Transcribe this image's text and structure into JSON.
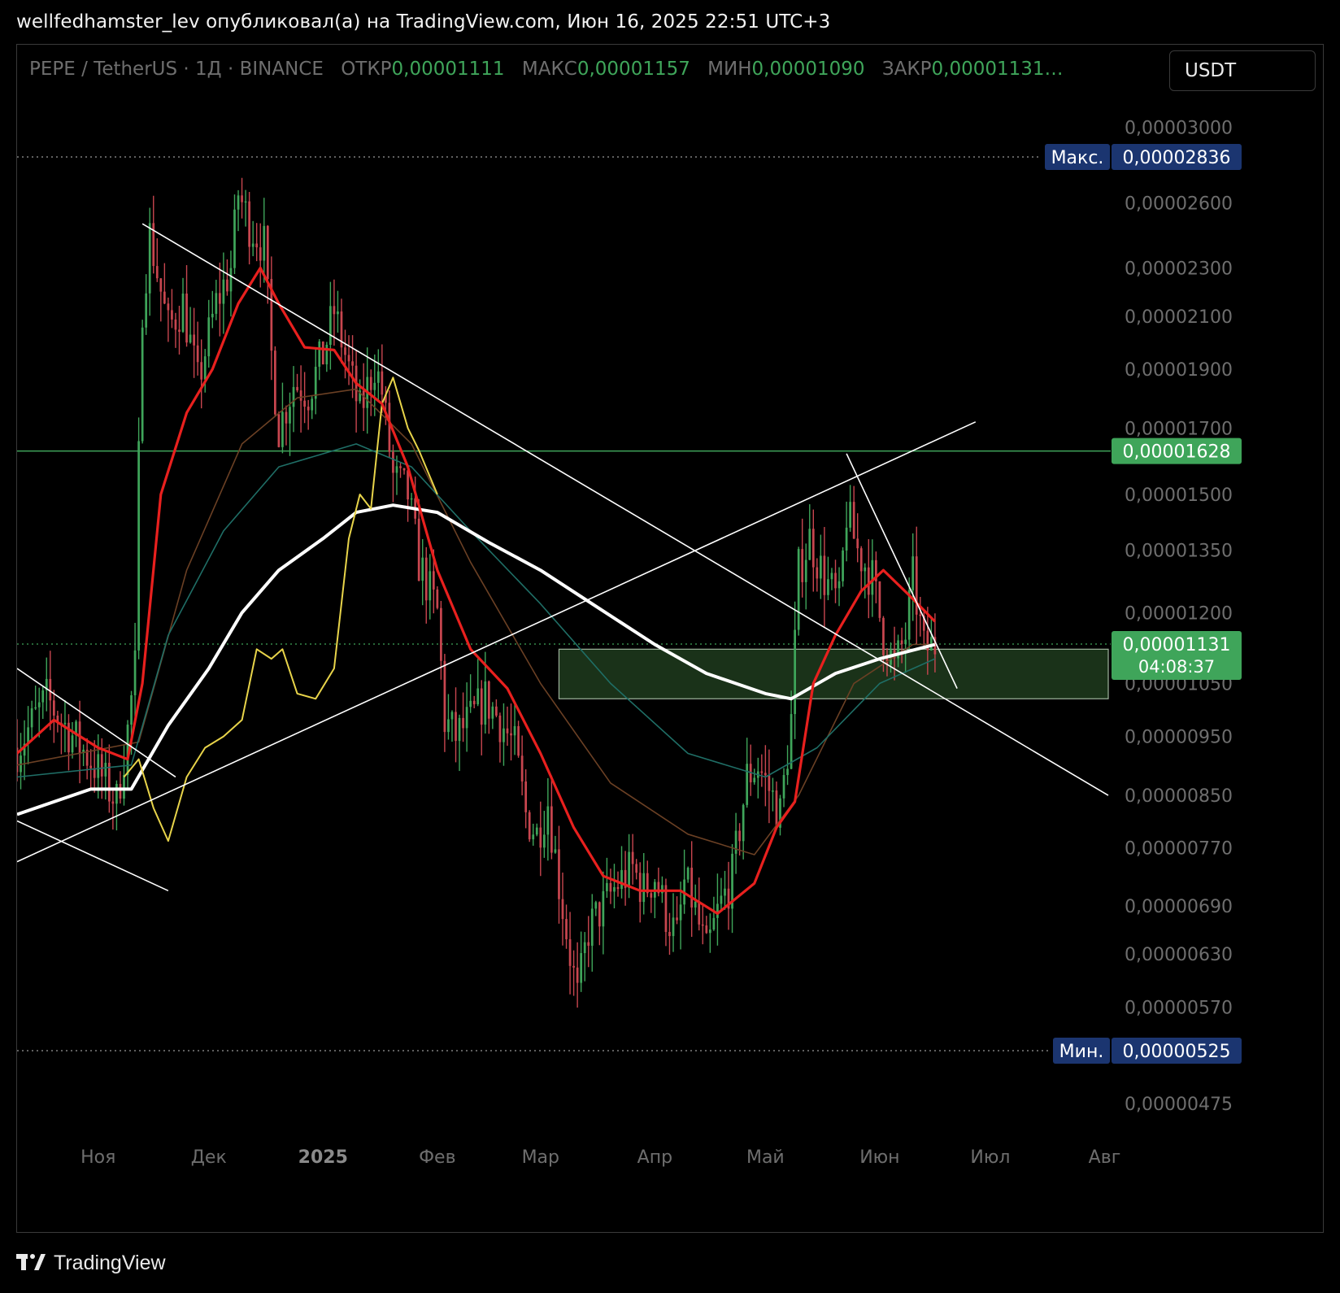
{
  "header": {
    "published_line": "wellfedhamster_lev опубликовал(а) на TradingView.com, Июн 16, 2025 22:51 UTC+3"
  },
  "legend": {
    "symbol": "PEPE / TetherUS · 1Д · BINANCE",
    "open_label": "ОТКР",
    "open_value": "0,00001111",
    "high_label": "МАКС",
    "high_value": "0,00001157",
    "low_label": "МИН",
    "low_value": "0,00001090",
    "close_label": "ЗАКР",
    "close_value": "0,00001131…"
  },
  "currency_selector": "USDT",
  "footer": {
    "brand": "TradingView"
  },
  "colors": {
    "up": "#3fa55a",
    "down": "#c8464f",
    "ma_red": "#e8201e",
    "ma_white": "#ffffff",
    "ma_teal": "#1f6e66",
    "ma_brown": "#6b4024",
    "oscillator": "#e8d44a",
    "zone_fill": "#1e3b1d",
    "price_tag_green": "#3fa55a",
    "extreme_tag": "#1b3570"
  },
  "chart_data": {
    "type": "candlestick",
    "pair": "PEPE / TetherUS",
    "interval": "1Д",
    "exchange": "BINANCE",
    "y_scale": "log",
    "ylim": [
      4.4e-06,
      3.2e-06
    ],
    "y_ticks": [
      "0,00003000",
      "0,00002600",
      "0,00002300",
      "0,00002100",
      "0,00001900",
      "0,00001700",
      "0,00001500",
      "0,00001350",
      "0,00001200",
      "0,00001050",
      "0,00000950",
      "0,00000850",
      "0,00000770",
      "0,00000690",
      "0,00000630",
      "0,00000570",
      "0,00000475"
    ],
    "y_tick_values": [
      3e-05,
      2.6e-05,
      2.3e-05,
      2.1e-05,
      1.9e-05,
      1.7e-05,
      1.5e-05,
      1.35e-05,
      1.2e-05,
      1.05e-05,
      9.5e-06,
      8.5e-06,
      7.7e-06,
      6.9e-06,
      6.3e-06,
      5.7e-06,
      4.75e-06
    ],
    "x_ticks": [
      "Ноя",
      "Дек",
      "2025",
      "Фев",
      "Мар",
      "Апр",
      "Май",
      "Июн",
      "Июл",
      "Авг"
    ],
    "x_tick_dates": [
      "2024-11-01",
      "2024-12-01",
      "2025-01-01",
      "2025-02-01",
      "2025-03-01",
      "2025-04-01",
      "2025-05-01",
      "2025-06-01",
      "2025-07-01",
      "2025-08-01"
    ],
    "x_range": [
      "2024-10-10",
      "2025-08-02"
    ],
    "max": {
      "label": "Макс.",
      "value": "0,00002836",
      "y": 2.836e-05,
      "date": "2024-12-09"
    },
    "min": {
      "label": "Мин.",
      "value": "0,00000525",
      "y": 5.25e-06,
      "date": "2025-03-11"
    },
    "current_price": {
      "value": "0,00001131",
      "countdown": "04:08:37",
      "y": 1.131e-05
    },
    "resistance_level": {
      "value": "0,00001628",
      "y": 1.628e-05
    },
    "support_zone": {
      "from": "2025-03-06",
      "to": "2025-08-02",
      "low": 1.02e-05,
      "high": 1.12e-05
    },
    "grid": false,
    "series_points": {
      "close": [
        [
          "2024-10-10",
          9.3e-06
        ],
        [
          "2024-10-18",
          1.02e-05
        ],
        [
          "2024-10-24",
          9.6e-06
        ],
        [
          "2024-10-31",
          9e-06
        ],
        [
          "2024-11-06",
          8.4e-06
        ],
        [
          "2024-11-09",
          9.6e-06
        ],
        [
          "2024-11-11",
          1.08e-05
        ],
        [
          "2024-11-12",
          1.6e-05
        ],
        [
          "2024-11-13",
          2.15e-05
        ],
        [
          "2024-11-15",
          2.45e-05
        ],
        [
          "2024-11-20",
          2.05e-05
        ],
        [
          "2024-11-24",
          2.15e-05
        ],
        [
          "2024-11-28",
          1.85e-05
        ],
        [
          "2024-12-03",
          2.15e-05
        ],
        [
          "2024-12-07",
          2.3e-05
        ],
        [
          "2024-12-09",
          2.65e-05
        ],
        [
          "2024-12-12",
          2.5e-05
        ],
        [
          "2024-12-16",
          2.4e-05
        ],
        [
          "2024-12-18",
          1.95e-05
        ],
        [
          "2024-12-20",
          1.7e-05
        ],
        [
          "2024-12-24",
          1.85e-05
        ],
        [
          "2024-12-28",
          1.82e-05
        ],
        [
          "2025-01-01",
          1.95e-05
        ],
        [
          "2025-01-04",
          2.12e-05
        ],
        [
          "2025-01-08",
          1.9e-05
        ],
        [
          "2025-01-11",
          1.75e-05
        ],
        [
          "2025-01-15",
          1.92e-05
        ],
        [
          "2025-01-17",
          1.82e-05
        ],
        [
          "2025-01-20",
          1.55e-05
        ],
        [
          "2025-01-24",
          1.5e-05
        ],
        [
          "2025-01-27",
          1.32e-05
        ],
        [
          "2025-02-01",
          1.2e-05
        ],
        [
          "2025-02-03",
          9.8e-06
        ],
        [
          "2025-02-06",
          9.5e-06
        ],
        [
          "2025-02-10",
          9.8e-06
        ],
        [
          "2025-02-14",
          1.02e-05
        ],
        [
          "2025-02-18",
          9.8e-06
        ],
        [
          "2025-02-22",
          9.3e-06
        ],
        [
          "2025-02-25",
          8.2e-06
        ],
        [
          "2025-02-28",
          7.9e-06
        ],
        [
          "2025-03-03",
          8.4e-06
        ],
        [
          "2025-03-06",
          7.2e-06
        ],
        [
          "2025-03-09",
          6.3e-06
        ],
        [
          "2025-03-11",
          5.8e-06
        ],
        [
          "2025-03-14",
          6.6e-06
        ],
        [
          "2025-03-18",
          6.9e-06
        ],
        [
          "2025-03-22",
          7.2e-06
        ],
        [
          "2025-03-26",
          7.4e-06
        ],
        [
          "2025-03-29",
          7.1e-06
        ],
        [
          "2025-04-01",
          7.3e-06
        ],
        [
          "2025-04-04",
          6.8e-06
        ],
        [
          "2025-04-07",
          6.5e-06
        ],
        [
          "2025-04-09",
          7.2e-06
        ],
        [
          "2025-04-11",
          7e-06
        ],
        [
          "2025-04-15",
          6.3e-06
        ],
        [
          "2025-04-18",
          6.8e-06
        ],
        [
          "2025-04-22",
          7.3e-06
        ],
        [
          "2025-04-26",
          8.8e-06
        ],
        [
          "2025-04-29",
          9e-06
        ],
        [
          "2025-05-02",
          8.6e-06
        ],
        [
          "2025-05-05",
          8.2e-06
        ],
        [
          "2025-05-08",
          9.8e-06
        ],
        [
          "2025-05-10",
          1.3e-05
        ],
        [
          "2025-05-13",
          1.38e-05
        ],
        [
          "2025-05-17",
          1.28e-05
        ],
        [
          "2025-05-21",
          1.22e-05
        ],
        [
          "2025-05-23",
          1.45e-05
        ],
        [
          "2025-05-26",
          1.35e-05
        ],
        [
          "2025-05-30",
          1.28e-05
        ],
        [
          "2025-06-02",
          1.15e-05
        ],
        [
          "2025-06-05",
          1.08e-05
        ],
        [
          "2025-06-08",
          1.15e-05
        ],
        [
          "2025-06-10",
          1.28e-05
        ],
        [
          "2025-06-13",
          1.12e-05
        ],
        [
          "2025-06-16",
          1.13e-05
        ]
      ],
      "ma_red": [
        [
          "2024-10-10",
          9.2e-06
        ],
        [
          "2024-10-20",
          9.8e-06
        ],
        [
          "2024-11-01",
          9.3e-06
        ],
        [
          "2024-11-09",
          9.1e-06
        ],
        [
          "2024-11-13",
          1.05e-05
        ],
        [
          "2024-11-18",
          1.5e-05
        ],
        [
          "2024-11-25",
          1.75e-05
        ],
        [
          "2024-12-02",
          1.9e-05
        ],
        [
          "2024-12-09",
          2.15e-05
        ],
        [
          "2024-12-15",
          2.3e-05
        ],
        [
          "2024-12-20",
          2.15e-05
        ],
        [
          "2024-12-27",
          1.98e-05
        ],
        [
          "2025-01-04",
          1.97e-05
        ],
        [
          "2025-01-10",
          1.85e-05
        ],
        [
          "2025-01-17",
          1.78e-05
        ],
        [
          "2025-01-24",
          1.58e-05
        ],
        [
          "2025-02-01",
          1.3e-05
        ],
        [
          "2025-02-10",
          1.12e-05
        ],
        [
          "2025-02-20",
          1.04e-05
        ],
        [
          "2025-03-01",
          9.2e-06
        ],
        [
          "2025-03-10",
          8e-06
        ],
        [
          "2025-03-18",
          7.3e-06
        ],
        [
          "2025-03-28",
          7.1e-06
        ],
        [
          "2025-04-08",
          7.1e-06
        ],
        [
          "2025-04-18",
          6.8e-06
        ],
        [
          "2025-04-28",
          7.2e-06
        ],
        [
          "2025-05-04",
          8e-06
        ],
        [
          "2025-05-09",
          8.4e-06
        ],
        [
          "2025-05-14",
          1.05e-05
        ],
        [
          "2025-05-20",
          1.15e-05
        ],
        [
          "2025-05-27",
          1.25e-05
        ],
        [
          "2025-06-02",
          1.3e-05
        ],
        [
          "2025-06-09",
          1.24e-05
        ],
        [
          "2025-06-16",
          1.18e-05
        ]
      ],
      "ma_white": [
        [
          "2024-10-10",
          8.2e-06
        ],
        [
          "2024-10-30",
          8.6e-06
        ],
        [
          "2024-11-10",
          8.6e-06
        ],
        [
          "2024-11-20",
          9.7e-06
        ],
        [
          "2024-12-01",
          1.08e-05
        ],
        [
          "2024-12-10",
          1.2e-05
        ],
        [
          "2024-12-20",
          1.3e-05
        ],
        [
          "2025-01-01",
          1.38e-05
        ],
        [
          "2025-01-10",
          1.45e-05
        ],
        [
          "2025-01-20",
          1.47e-05
        ],
        [
          "2025-02-01",
          1.45e-05
        ],
        [
          "2025-02-15",
          1.37e-05
        ],
        [
          "2025-03-01",
          1.3e-05
        ],
        [
          "2025-03-15",
          1.22e-05
        ],
        [
          "2025-04-01",
          1.13e-05
        ],
        [
          "2025-04-15",
          1.07e-05
        ],
        [
          "2025-05-01",
          1.03e-05
        ],
        [
          "2025-05-08",
          1.02e-05
        ],
        [
          "2025-05-20",
          1.07e-05
        ],
        [
          "2025-06-01",
          1.1e-05
        ],
        [
          "2025-06-16",
          1.13e-05
        ]
      ],
      "ma_teal": [
        [
          "2024-10-10",
          8.8e-06
        ],
        [
          "2024-11-10",
          9e-06
        ],
        [
          "2024-11-20",
          1.15e-05
        ],
        [
          "2024-12-05",
          1.4e-05
        ],
        [
          "2024-12-20",
          1.58e-05
        ],
        [
          "2025-01-10",
          1.65e-05
        ],
        [
          "2025-01-25",
          1.58e-05
        ],
        [
          "2025-02-10",
          1.4e-05
        ],
        [
          "2025-03-01",
          1.22e-05
        ],
        [
          "2025-03-20",
          1.05e-05
        ],
        [
          "2025-04-10",
          9.2e-06
        ],
        [
          "2025-05-01",
          8.8e-06
        ],
        [
          "2025-05-15",
          9.3e-06
        ],
        [
          "2025-06-01",
          1.05e-05
        ],
        [
          "2025-06-16",
          1.1e-05
        ]
      ],
      "ma_brown": [
        [
          "2024-10-10",
          9e-06
        ],
        [
          "2024-11-12",
          9.4e-06
        ],
        [
          "2024-11-25",
          1.3e-05
        ],
        [
          "2024-12-10",
          1.65e-05
        ],
        [
          "2024-12-25",
          1.8e-05
        ],
        [
          "2025-01-10",
          1.83e-05
        ],
        [
          "2025-01-25",
          1.65e-05
        ],
        [
          "2025-02-10",
          1.32e-05
        ],
        [
          "2025-03-01",
          1.05e-05
        ],
        [
          "2025-03-20",
          8.7e-06
        ],
        [
          "2025-04-10",
          7.9e-06
        ],
        [
          "2025-04-28",
          7.6e-06
        ],
        [
          "2025-05-10",
          8.5e-06
        ],
        [
          "2025-05-25",
          1.05e-05
        ],
        [
          "2025-06-10",
          1.13e-05
        ],
        [
          "2025-06-16",
          1.13e-05
        ]
      ],
      "oscillator_yellow": [
        [
          "2024-11-08",
          8.8e-06
        ],
        [
          "2024-11-12",
          9.1e-06
        ],
        [
          "2024-11-16",
          8.3e-06
        ],
        [
          "2024-11-20",
          7.8e-06
        ],
        [
          "2024-11-25",
          8.8e-06
        ],
        [
          "2024-11-30",
          9.3e-06
        ],
        [
          "2024-12-05",
          9.5e-06
        ],
        [
          "2024-12-10",
          9.8e-06
        ],
        [
          "2024-12-14",
          1.12e-05
        ],
        [
          "2024-12-18",
          1.1e-05
        ],
        [
          "2024-12-21",
          1.12e-05
        ],
        [
          "2024-12-25",
          1.03e-05
        ],
        [
          "2024-12-30",
          1.02e-05
        ],
        [
          "2025-01-04",
          1.08e-05
        ],
        [
          "2025-01-08",
          1.38e-05
        ],
        [
          "2025-01-11",
          1.5e-05
        ],
        [
          "2025-01-14",
          1.46e-05
        ],
        [
          "2025-01-17",
          1.78e-05
        ],
        [
          "2025-01-20",
          1.87e-05
        ],
        [
          "2025-01-24",
          1.7e-05
        ],
        [
          "2025-01-27",
          1.63e-05
        ],
        [
          "2025-02-01",
          1.5e-05
        ]
      ]
    },
    "trendlines": [
      {
        "from": [
          "2024-11-13",
          2.5e-05
        ],
        "to": [
          "2025-08-02",
          8.5e-06
        ]
      },
      {
        "from": [
          "2024-10-10",
          7.5e-06
        ],
        "to": [
          "2025-06-27",
          1.72e-05
        ]
      },
      {
        "from": [
          "2025-05-23",
          1.62e-05
        ],
        "to": [
          "2025-06-22",
          1.04e-05
        ]
      },
      {
        "from": [
          "2024-10-10",
          1.08e-05
        ],
        "to": [
          "2024-11-22",
          8.8e-06
        ]
      },
      {
        "from": [
          "2024-10-10",
          8.1e-06
        ],
        "to": [
          "2024-11-20",
          7.1e-06
        ]
      }
    ]
  }
}
